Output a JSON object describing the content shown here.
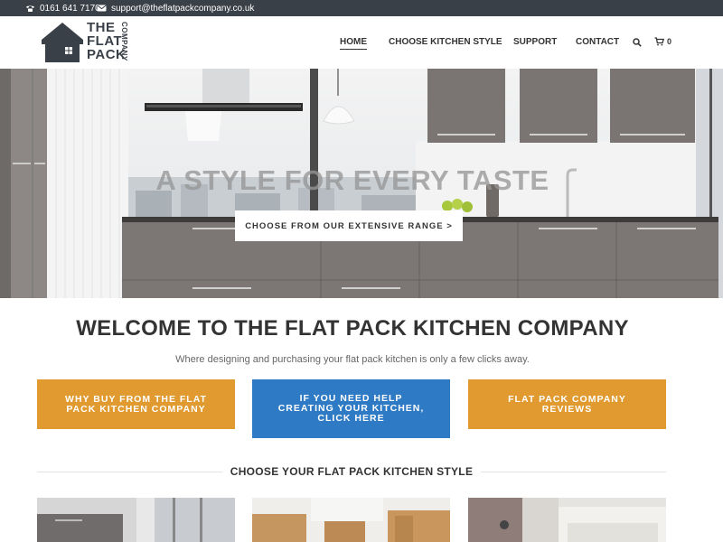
{
  "topbar": {
    "phone": "0161 641 7170",
    "email": "support@theflatpackcompany.co.uk",
    "phone_icon": "phone-icon",
    "email_icon": "envelope-icon"
  },
  "logo": {
    "line1": "THE",
    "line2": "FLAT",
    "line3": "PACK",
    "side": "COMPANY"
  },
  "nav": {
    "home": "HOME",
    "choose_style": "CHOOSE KITCHEN STYLE",
    "support": "SUPPORT",
    "contact": "CONTACT",
    "cart_count": "0",
    "search_icon": "search-icon",
    "cart_icon": "cart-icon"
  },
  "hero": {
    "headline": "A STYLE FOR EVERY TASTE",
    "cta": "CHOOSE FROM OUR EXTENSIVE RANGE >"
  },
  "welcome": {
    "title": "WELCOME TO THE FLAT PACK KITCHEN COMPANY",
    "subtitle": "Where designing and purchasing your flat pack kitchen is only a few clicks away."
  },
  "cta_buttons": [
    {
      "label": "WHY BUY FROM THE FLAT PACK KITCHEN COMPANY",
      "color": "#e09a2f"
    },
    {
      "label": "IF YOU NEED HELP CREATING YOUR KITCHEN, CLICK HERE",
      "color": "#2f7ac4"
    },
    {
      "label": "FLAT PACK COMPANY REVIEWS",
      "color": "#e09a2f"
    }
  ],
  "styles_section": {
    "title": "CHOOSE YOUR FLAT PACK KITCHEN STYLE"
  },
  "colors": {
    "topbar": "#3a4048",
    "accent_orange": "#e09a2f",
    "accent_blue": "#2f7ac4"
  }
}
